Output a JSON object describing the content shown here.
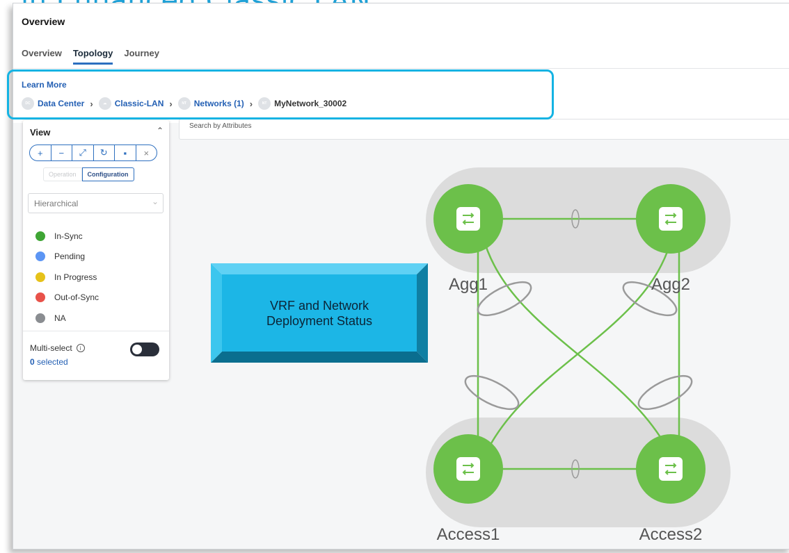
{
  "slide_title": "in Enhanced Classic LAN",
  "header": {
    "title": "Overview"
  },
  "tabs": [
    {
      "label": "Overview",
      "active": false
    },
    {
      "label": "Topology",
      "active": true
    },
    {
      "label": "Journey",
      "active": false
    }
  ],
  "learn_more": "Learn More",
  "breadcrumb": [
    {
      "label": "Data Center",
      "icon": "data-center-icon"
    },
    {
      "label": "Classic-LAN",
      "icon": "cloud-icon"
    },
    {
      "label": "Networks (1)",
      "icon": "networks-icon"
    },
    {
      "label": "MyNetwork_30002",
      "icon": "network-icon"
    }
  ],
  "search": {
    "placeholder": "Search by Attributes"
  },
  "view_panel": {
    "title": "View",
    "toolbar": [
      "zoom-in-icon",
      "zoom-out-icon",
      "fit-screen-icon",
      "refresh-icon",
      "save-icon",
      "close-icon"
    ],
    "modes": {
      "operation": "Operation",
      "configuration": "Configuration",
      "active": "configuration"
    },
    "layout_select": "Hierarchical",
    "legend": [
      {
        "label": "In-Sync",
        "color": "#3fa535"
      },
      {
        "label": "Pending",
        "color": "#5c95f4"
      },
      {
        "label": "In Progress",
        "color": "#e6c21a"
      },
      {
        "label": "Out-of-Sync",
        "color": "#e8524a"
      },
      {
        "label": "NA",
        "color": "#8a8d91"
      }
    ],
    "multi_select": {
      "label": "Multi-select",
      "enabled": false
    },
    "selected": {
      "count": "0",
      "suffix": " selected"
    }
  },
  "callout": {
    "line1": "VRF and Network",
    "line2": "Deployment Status"
  },
  "topology": {
    "nodes": [
      {
        "name": "Agg1",
        "status": "In-Sync"
      },
      {
        "name": "Agg2",
        "status": "In-Sync"
      },
      {
        "name": "Access1",
        "status": "In-Sync"
      },
      {
        "name": "Access2",
        "status": "In-Sync"
      }
    ]
  },
  "colors": {
    "accent": "#2d6fbf",
    "highlight": "#14b3e3",
    "node_green": "#6cc04a",
    "callout": "#1fb8e8"
  }
}
